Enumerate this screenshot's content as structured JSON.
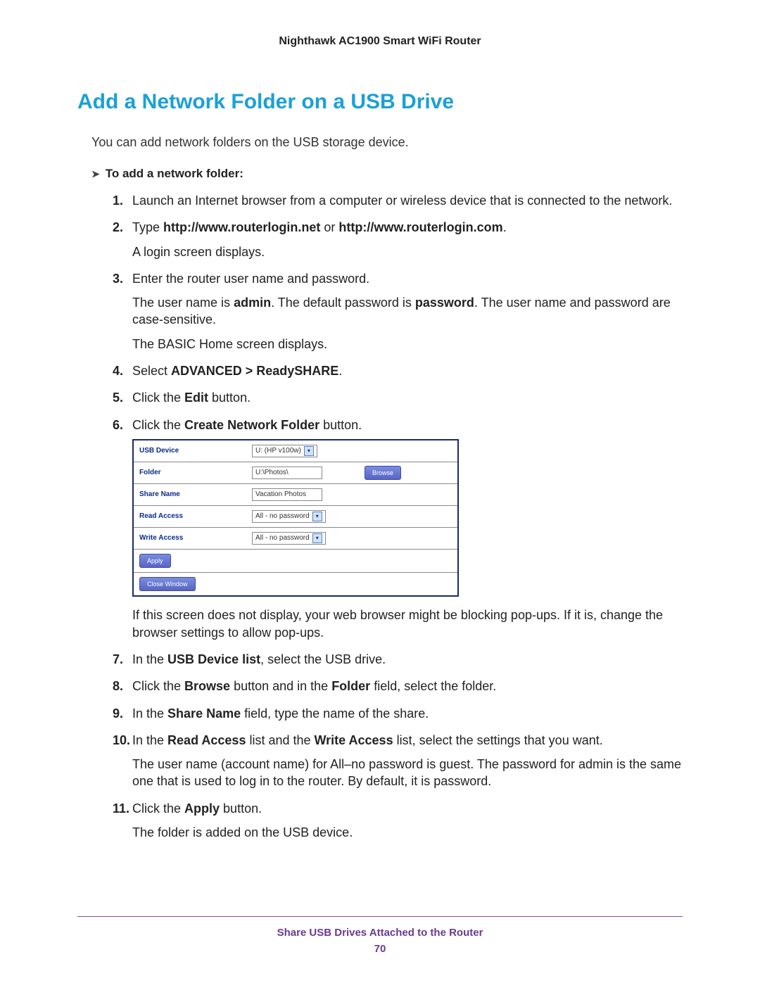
{
  "header": {
    "title": "Nighthawk AC1900 Smart WiFi Router"
  },
  "section": {
    "title": "Add a Network Folder on a USB Drive",
    "intro": "You can add network folders on the USB storage device.",
    "subhead": "To add a network folder:"
  },
  "steps": {
    "s1": "Launch an Internet browser from a computer or wireless device that is connected to the network.",
    "s2_pre": "Type ",
    "s2_url1": "http://www.routerlogin.net",
    "s2_mid": " or ",
    "s2_url2": "http://www.routerlogin.com",
    "s2_post": ".",
    "s2_p2": "A login screen displays.",
    "s3": "Enter the router user name and password.",
    "s3_p2a": "The user name is ",
    "s3_admin": "admin",
    "s3_p2b": ". The default password is ",
    "s3_pwd": "password",
    "s3_p2c": ". The user name and password are case-sensitive.",
    "s3_p3": "The BASIC Home screen displays.",
    "s4_pre": "Select ",
    "s4_nav": "ADVANCED > ReadySHARE",
    "s4_post": ".",
    "s5_pre": "Click the ",
    "s5_btn": "Edit",
    "s5_post": " button.",
    "s6_pre": "Click the ",
    "s6_btn": "Create Network Folder",
    "s6_post": " button.",
    "s6_p2": "If this screen does not display, your web browser might be blocking pop-ups. If it is, change the browser settings to allow pop-ups.",
    "s7_pre": "In the ",
    "s7_b": "USB Device list",
    "s7_post": ", select the USB drive.",
    "s8_pre": "Click the ",
    "s8_b1": "Browse",
    "s8_mid": " button and in the ",
    "s8_b2": "Folder",
    "s8_post": " field, select the folder.",
    "s9_pre": "In the ",
    "s9_b": "Share Name",
    "s9_post": " field, type the name of the share.",
    "s10_pre": "In the ",
    "s10_b1": "Read Access",
    "s10_mid": " list and the ",
    "s10_b2": "Write Access",
    "s10_post": " list, select the settings that you want.",
    "s10_p2": "The user name (account name) for All–no password is guest. The password for admin is the same one that is used to log in to the router. By default, it is password.",
    "s11_pre": "Click the ",
    "s11_b": "Apply",
    "s11_post": " button.",
    "s11_p2": "The folder is added on the USB device."
  },
  "dialog": {
    "rows": {
      "usb_device": {
        "label": "USB Device",
        "value": "U: (HP v100w)"
      },
      "folder": {
        "label": "Folder",
        "value": "U:\\Photos\\",
        "browse": "Browse"
      },
      "share_name": {
        "label": "Share Name",
        "value": "Vacation Photos"
      },
      "read_access": {
        "label": "Read Access",
        "value": "All - no password"
      },
      "write_access": {
        "label": "Write Access",
        "value": "All - no password"
      }
    },
    "buttons": {
      "apply": "Apply",
      "close": "Close Window"
    }
  },
  "footer": {
    "text": "Share USB Drives Attached to the Router",
    "page": "70"
  }
}
